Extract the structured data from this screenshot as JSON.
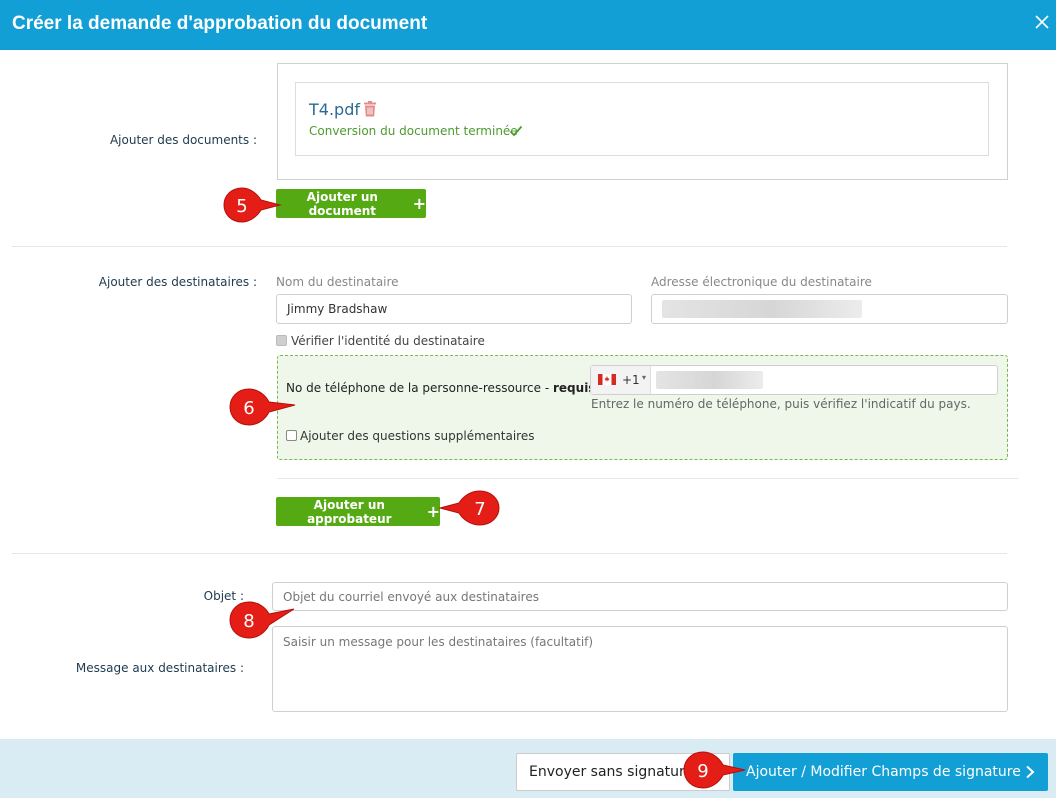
{
  "dialog": {
    "title": "Créer la demande d'approbation du document"
  },
  "documents": {
    "label": "Ajouter des documents :",
    "file_name": "T4.pdf",
    "status": "Conversion du document terminée",
    "add_button": "Ajouter un document"
  },
  "recipients": {
    "label": "Ajouter des destinataires :",
    "name_label": "Nom du destinataire",
    "name_value": "Jimmy Bradshaw",
    "email_label": "Adresse électronique du destinataire",
    "verify_label": "Vérifier l'identité du destinataire",
    "phone_label": "No de téléphone de la personne-ressource - ",
    "phone_required": "requis",
    "country_code": "+1",
    "phone_hint": "Entrez le numéro de téléphone, puis vérifiez l'indicatif du pays.",
    "extra_questions": "Ajouter des questions supplémentaires",
    "add_approver_button": "Ajouter un approbateur"
  },
  "message": {
    "subject_label": "Objet :",
    "subject_placeholder": "Objet du courriel envoyé aux destinataires",
    "body_label": "Message aux destinataires :",
    "body_placeholder": "Saisir un message pour les destinataires (facultatif)"
  },
  "footer": {
    "send_without_signature": "Envoyer sans signature",
    "add_fields": "Ajouter / Modifier Champs de signature"
  },
  "callouts": [
    "5",
    "6",
    "7",
    "8",
    "9"
  ],
  "colors": {
    "header": "#119fd6",
    "green_button": "#55a913",
    "callout": "#e41e16"
  }
}
